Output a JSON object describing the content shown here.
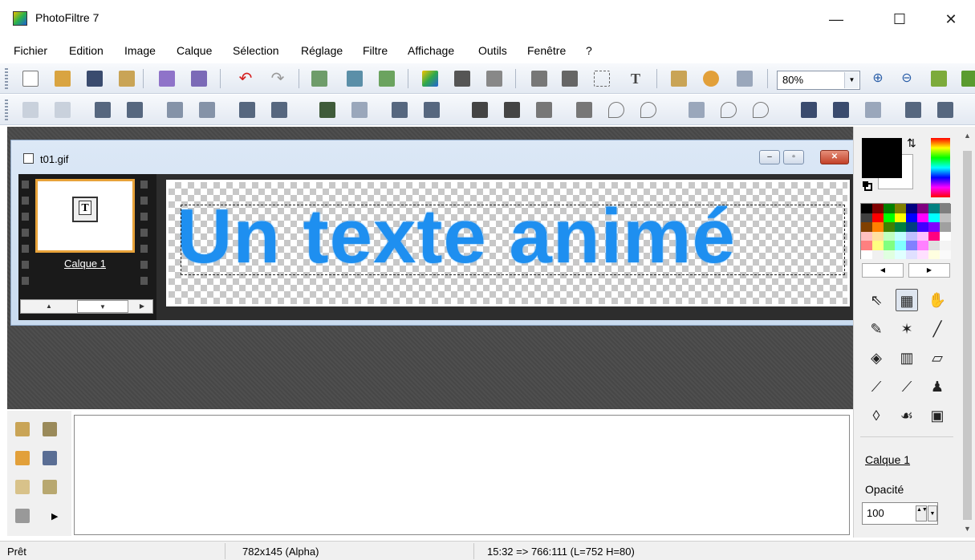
{
  "window": {
    "title": "PhotoFiltre 7",
    "minimize": "—",
    "maximize": "☐",
    "close": "✕"
  },
  "menu": [
    "Fichier",
    "Edition",
    "Image",
    "Calque",
    "Sélection",
    "Réglage",
    "Filtre",
    "Affichage",
    "Outils",
    "Fenêtre",
    "?"
  ],
  "toolbar": {
    "zoom_value": "80%",
    "zoom_arrow": "▼"
  },
  "document": {
    "title": "t01.gif",
    "min": "–",
    "restore": "▫",
    "close": "✕",
    "canvas_text": "Un texte animé"
  },
  "filmstrip": {
    "layer_name": "Calque 1",
    "thumb_glyph": "T",
    "scroll_up": "▲",
    "scroll_down": "▼",
    "scroll_right": "▶"
  },
  "palette": {
    "prev": "◀",
    "next": "▶",
    "colors": [
      "#000000",
      "#7f0000",
      "#007f00",
      "#7f7f00",
      "#00007f",
      "#7f007f",
      "#007f7f",
      "#7f7f7f",
      "#3f3f3f",
      "#ff0000",
      "#00ff00",
      "#ffff00",
      "#0000ff",
      "#ff00ff",
      "#00ffff",
      "#c0c0c0",
      "#804000",
      "#ff8000",
      "#408000",
      "#008040",
      "#004080",
      "#4000ff",
      "#8000ff",
      "#a0a0a0",
      "#ffc0c0",
      "#ffe0a0",
      "#c0ffc0",
      "#c0ffff",
      "#c0c0ff",
      "#ffc0ff",
      "#ff0080",
      "#ffffff",
      "#ff8080",
      "#ffff80",
      "#80ff80",
      "#80ffff",
      "#8080ff",
      "#ff80ff",
      "#e0e0e0",
      "#f4f4f4",
      "#ffffff",
      "#f0f0f0",
      "#e0ffe0",
      "#e0ffff",
      "#e0e0ff",
      "#ffe0ff",
      "#ffffe0",
      "#fafafa"
    ]
  },
  "tools": {
    "swap_glyph": "⇅",
    "items": [
      {
        "name": "pointer-tool-icon",
        "glyph": "⇖"
      },
      {
        "name": "selection-tool-icon",
        "glyph": "▦"
      },
      {
        "name": "hand-tool-icon",
        "glyph": "✋"
      },
      {
        "name": "eyedropper-tool-icon",
        "glyph": "✎"
      },
      {
        "name": "magic-wand-tool-icon",
        "glyph": "✶"
      },
      {
        "name": "line-tool-icon",
        "glyph": "╱"
      },
      {
        "name": "fill-tool-icon",
        "glyph": "◈"
      },
      {
        "name": "spray-tool-icon",
        "glyph": "▥"
      },
      {
        "name": "eraser-tool-icon",
        "glyph": "▱"
      },
      {
        "name": "brush-tool-icon",
        "glyph": "⟋"
      },
      {
        "name": "advanced-brush-tool-icon",
        "glyph": "⟋"
      },
      {
        "name": "stamp-tool-icon",
        "glyph": "♟"
      },
      {
        "name": "blur-tool-icon",
        "glyph": "◊"
      },
      {
        "name": "smudge-tool-icon",
        "glyph": "☙"
      },
      {
        "name": "clone-tool-icon",
        "glyph": "▣"
      }
    ]
  },
  "layer_panel": {
    "layer": "Calque 1",
    "opacity_label": "Opacité",
    "opacity_value": "100",
    "spin": "▲▼",
    "drop": "▼",
    "more": "▶"
  },
  "scroll": {
    "up": "▲",
    "down": "▼"
  },
  "status": {
    "state": "Prêt",
    "image_size": "782x145 (Alpha)",
    "coords": "15:32 => 766:111 (L=752  H=80)"
  },
  "colors": {
    "accent_orange": "#e8a33a",
    "text_blue": "#1e8ff0",
    "fg": "#000000",
    "bg": "#ffffff"
  }
}
